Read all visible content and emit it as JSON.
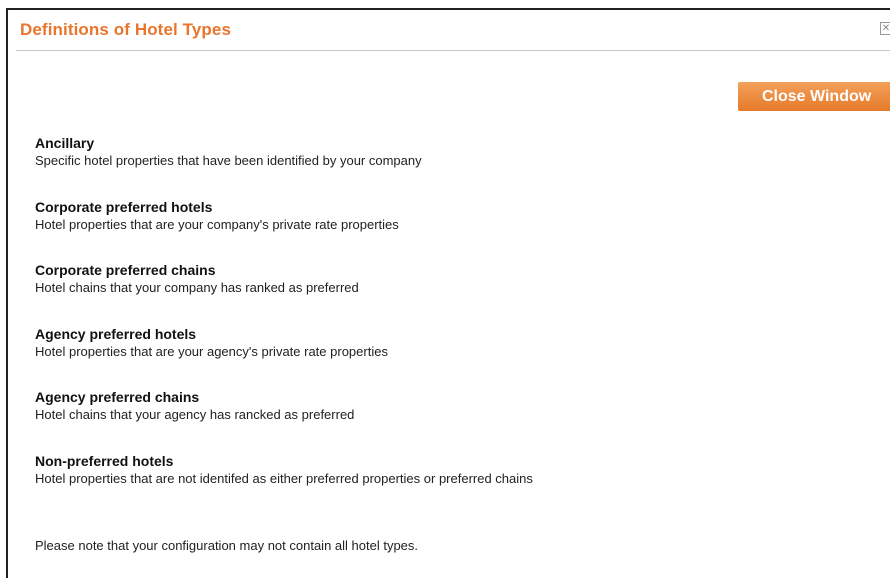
{
  "dialog": {
    "title": "Definitions of Hotel Types",
    "close_icon": "close-x-icon",
    "close_button_label": "Close Window",
    "accent_color": "#e8762d"
  },
  "definitions": [
    {
      "title": "Ancillary",
      "description": "Specific hotel properties that have been identified by your company"
    },
    {
      "title": "Corporate preferred hotels",
      "description": "Hotel properties that are your company's private rate properties"
    },
    {
      "title": "Corporate preferred chains",
      "description": "Hotel chains that your company has ranked as preferred"
    },
    {
      "title": "Agency preferred hotels",
      "description": "Hotel properties that are your agency's private rate properties"
    },
    {
      "title": "Agency preferred chains",
      "description": "Hotel chains that your agency has rancked as preferred"
    },
    {
      "title": "Non-preferred hotels",
      "description": "Hotel properties that are not identifed as either preferred properties or preferred chains"
    }
  ],
  "note": "Please note that your configuration may not contain all hotel types."
}
